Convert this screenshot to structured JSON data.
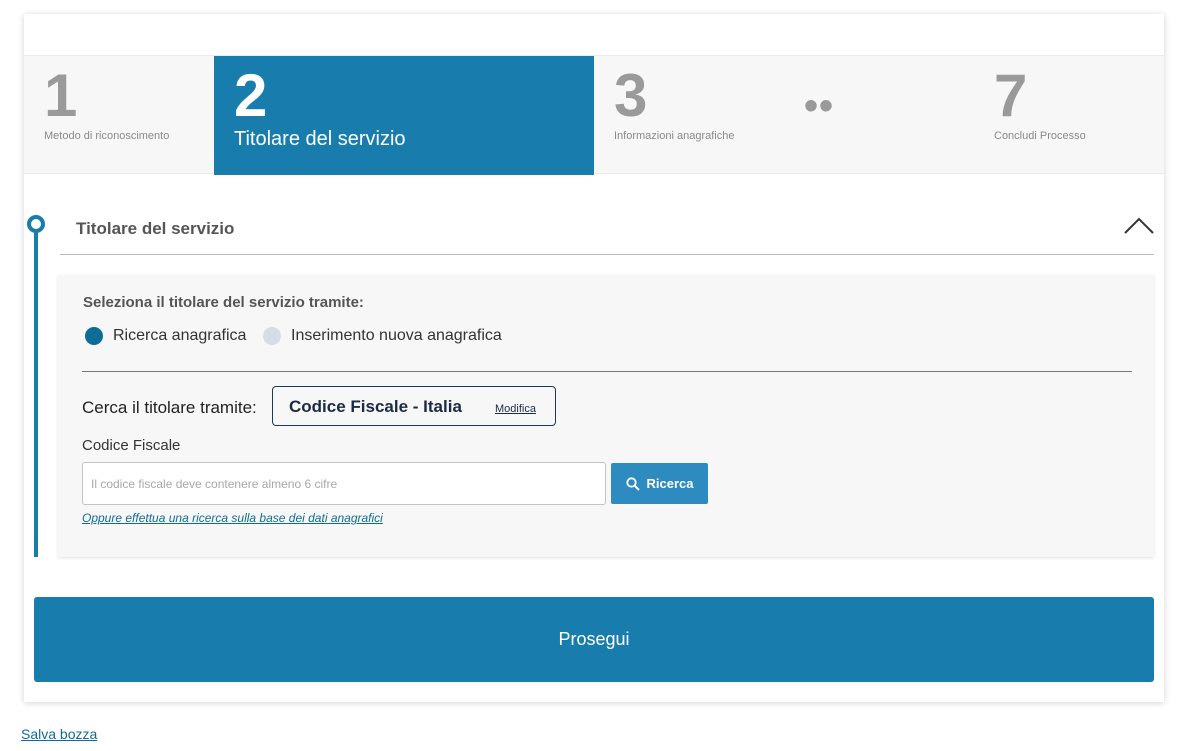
{
  "stepper": {
    "steps": [
      {
        "num": "1",
        "label": "Metodo di riconoscimento"
      },
      {
        "num": "2",
        "label": "Titolare del servizio"
      },
      {
        "num": "3",
        "label": "Informazioni anagrafiche"
      },
      {
        "num": "7",
        "label": "Concludi Processo"
      }
    ],
    "ellipsis": "••"
  },
  "section": {
    "title": "Titolare del servizio"
  },
  "panel": {
    "select_label": "Seleziona il titolare del servizio tramite:",
    "radio_options": [
      "Ricerca anagrafica",
      "Inserimento nuova anagrafica"
    ],
    "cerca_label": "Cerca il titolare tramite:",
    "cerca_value": "Codice Fiscale - Italia",
    "modifica_label": "Modifica",
    "cf_label": "Codice Fiscale",
    "cf_placeholder": "Il codice fiscale deve contenere almeno 6 cifre",
    "search_button": "Ricerca",
    "alt_link": "Oppure effettua una ricerca sulla base dei dati anagrafici"
  },
  "actions": {
    "prosegui": "Prosegui",
    "salva_bozza": "Salva bozza"
  },
  "colors": {
    "primary": "#187dad",
    "radio_selected": "#0e6d96",
    "button": "#2e8bc0"
  }
}
